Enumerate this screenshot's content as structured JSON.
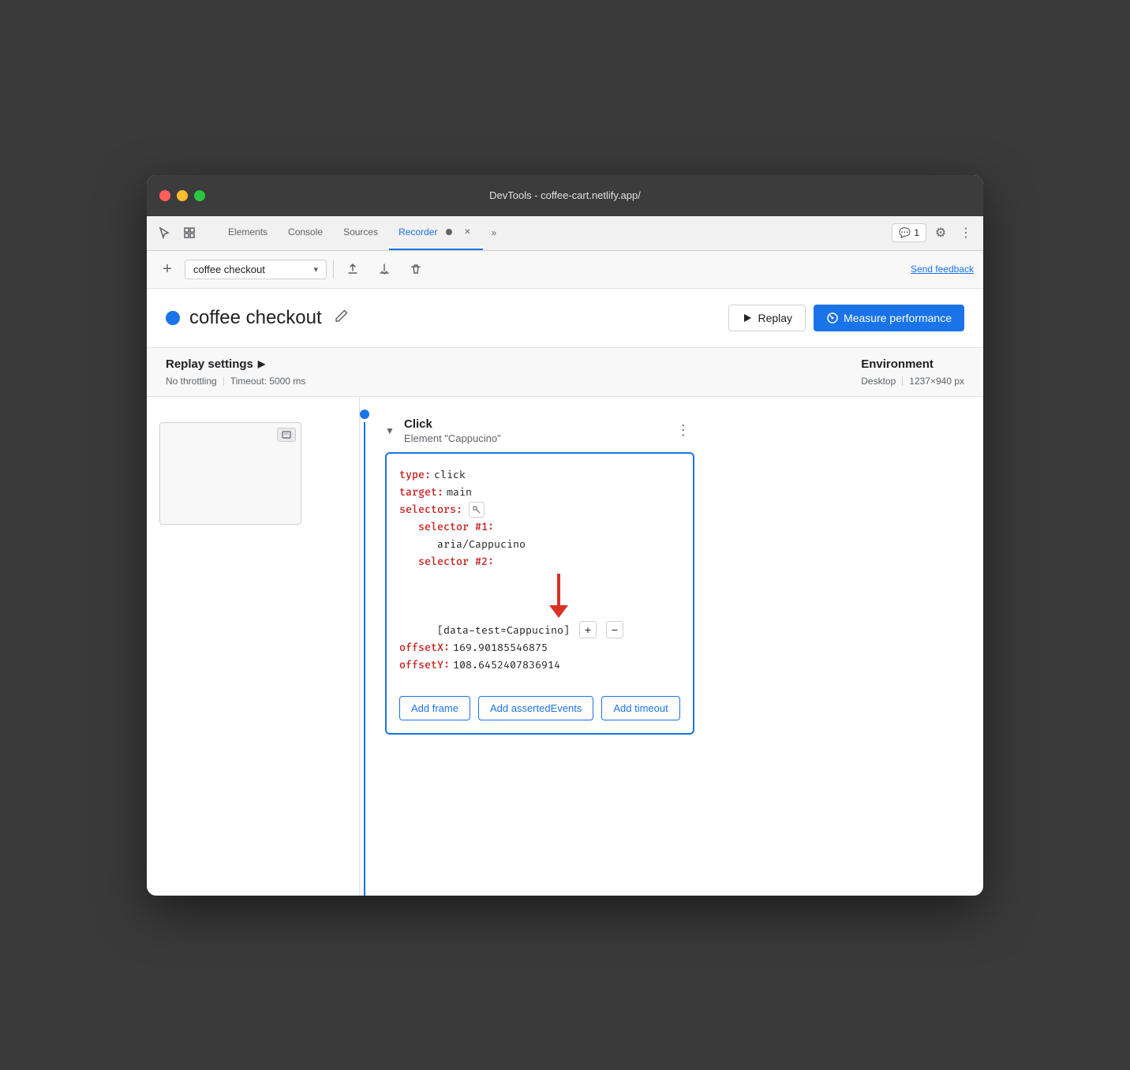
{
  "window": {
    "title": "DevTools - coffee-cart.netlify.app/"
  },
  "traffic_lights": {
    "close_label": "close",
    "minimize_label": "minimize",
    "maximize_label": "maximize"
  },
  "tabs": [
    {
      "id": "elements",
      "label": "Elements",
      "active": false
    },
    {
      "id": "console",
      "label": "Console",
      "active": false
    },
    {
      "id": "sources",
      "label": "Sources",
      "active": false
    },
    {
      "id": "recorder",
      "label": "Recorder",
      "active": true
    },
    {
      "id": "more",
      "label": "»",
      "active": false
    }
  ],
  "notification": {
    "icon": "💬",
    "count": "1"
  },
  "toolbar": {
    "add_label": "+",
    "recording_name": "coffee checkout",
    "send_feedback_label": "Send feedback"
  },
  "header": {
    "title": "coffee checkout",
    "replay_label": "Replay",
    "measure_label": "Measure performance"
  },
  "replay_settings": {
    "title": "Replay settings",
    "arrow": "▶",
    "throttling": "No throttling",
    "timeout": "Timeout: 5000 ms"
  },
  "environment": {
    "title": "Environment",
    "type": "Desktop",
    "size": "1237×940 px"
  },
  "step": {
    "type": "Click",
    "subtitle": "Element \"Cappucino\"",
    "more_icon": "⋮"
  },
  "code": {
    "type_key": "type:",
    "type_val": "click",
    "target_key": "target:",
    "target_val": "main",
    "selectors_key": "selectors:",
    "selector1_key": "selector #1:",
    "selector1_val": "aria/Cappucino",
    "selector2_key": "selector #2:",
    "selector2_val": "[data-test=Cappucino]",
    "offsetX_key": "offsetX:",
    "offsetX_val": "169.90185546875",
    "offsetY_key": "offsetY:",
    "offsetY_val": "108.6452407836914"
  },
  "action_buttons": {
    "add_frame": "Add frame",
    "add_asserted": "Add assertedEvents",
    "add_timeout": "Add timeout"
  },
  "icons": {
    "cursor": "⬡",
    "copy": "⧉",
    "upload": "↑",
    "download": "↓",
    "delete": "🗑",
    "settings": "⚙",
    "more_vert": "⋮",
    "chevron_down": "▾",
    "play": "▷",
    "edit": "✎",
    "selector_icon": "⬡",
    "expand_arrow": "▼"
  },
  "colors": {
    "accent": "#1a73e8",
    "dot_blue": "#1a73e8",
    "text_primary": "#202124",
    "text_secondary": "#5f6368",
    "red": "#d93025",
    "key_color": "#c5221f",
    "border": "#d0d0d0"
  }
}
